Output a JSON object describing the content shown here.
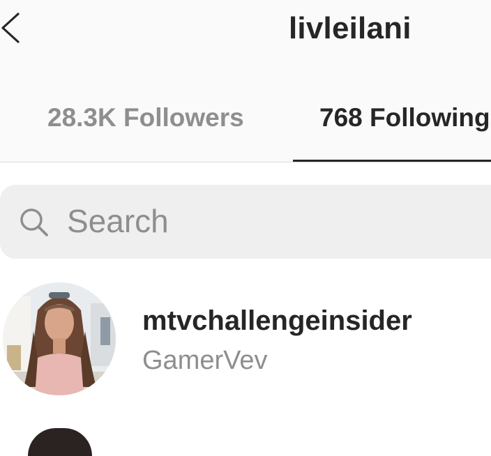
{
  "header": {
    "title": "livleilani",
    "back_icon": "chevron-left-icon"
  },
  "tabs": [
    {
      "label": "28.3K Followers",
      "active": false
    },
    {
      "label": "768 Following",
      "active": true
    }
  ],
  "search": {
    "placeholder": "Search",
    "value": "",
    "icon": "search-icon"
  },
  "list": [
    {
      "username": "mtvchallengeinsider",
      "full_name": "GamerVev"
    }
  ],
  "colors": {
    "primary_text": "#262626",
    "secondary_text": "#8e8e8e",
    "header_bg": "#fafafa",
    "search_bg": "#efefef",
    "divider": "#dbdbdb"
  }
}
